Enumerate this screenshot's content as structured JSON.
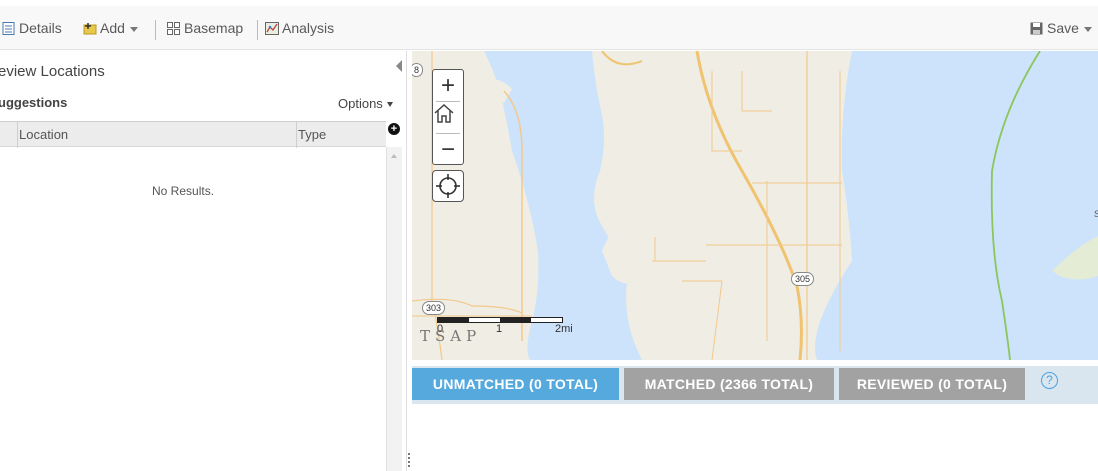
{
  "toolbar": {
    "details": "Details",
    "add": "Add",
    "basemap": "Basemap",
    "analysis": "Analysis",
    "save": "Save"
  },
  "panel": {
    "title": "eview Locations",
    "suggestions_title": "uggestions",
    "options": "Options",
    "columns": [
      "Location",
      "Type"
    ],
    "empty_message": "No Results."
  },
  "map": {
    "zoom_in": "+",
    "zoom_out": "−",
    "scale_labels": [
      "0",
      "1",
      "2mi"
    ],
    "attribution": "TSAP",
    "route_shields": [
      "8",
      "303",
      "305"
    ],
    "place_label": "S",
    "colors": {
      "water": "#cce3fb",
      "land": "#efede4",
      "roads": "#f3c98a",
      "trail": "#8cc65a"
    }
  },
  "tabs": {
    "unmatched": "UNMATCHED (0 TOTAL)",
    "matched": "MATCHED (2366 TOTAL)",
    "reviewed": "REVIEWED (0 TOTAL)",
    "help": "?",
    "colors": {
      "active": "#56a9dd",
      "inactive": "#a2a2a2"
    }
  }
}
